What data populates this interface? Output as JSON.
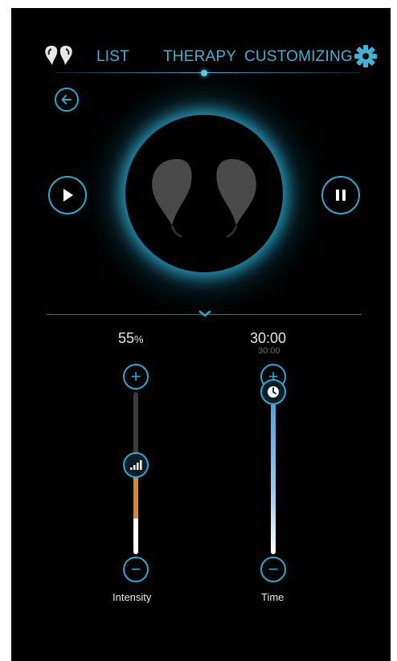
{
  "nav": {
    "tabs": [
      {
        "label": "LIST"
      },
      {
        "label": "THERAPY"
      },
      {
        "label": "CUSTOMIZING"
      }
    ],
    "active_tab": "THERAPY",
    "accent_color": "#3fb3d6",
    "icons": [
      "earbuds-logo-icon",
      "gear-icon",
      "back-arrow-icon",
      "play-icon",
      "pause-icon",
      "chevron-down-icon"
    ]
  },
  "intensity": {
    "value_label": "55",
    "unit": "%",
    "level": 0.55,
    "caption": "Intensity",
    "color": "#d38a2e"
  },
  "time": {
    "value_label": "30:00",
    "sub_label": "30:00",
    "level": 1.0,
    "caption": "Time",
    "color": "#3a9fe0"
  }
}
